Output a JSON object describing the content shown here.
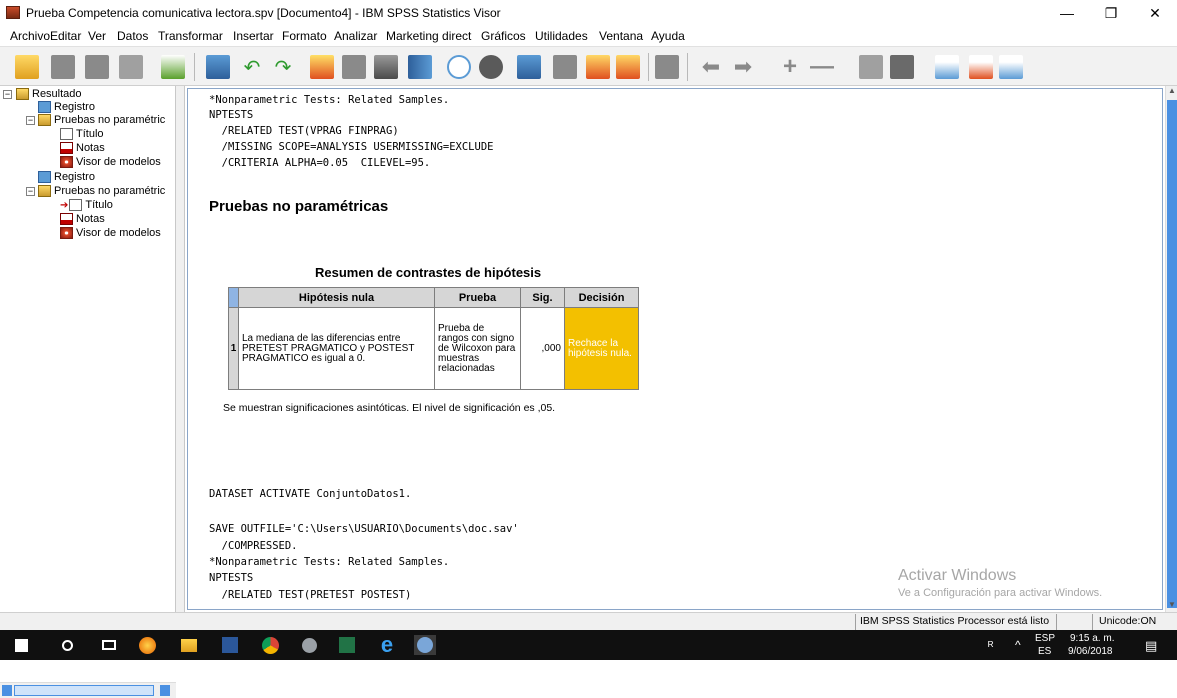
{
  "window": {
    "title": "Prueba Competencia comunicativa lectora.spv [Documento4] - IBM SPSS Statistics Visor",
    "minimize_glyph": "—",
    "maximize_glyph": "❐",
    "close_glyph": "✕"
  },
  "menu": [
    "Archivo",
    "Editar",
    "Ver",
    "Datos",
    "Transformar",
    "Insertar",
    "Formato",
    "Analizar",
    "Marketing direct",
    "Gráficos",
    "Utilidades",
    "Ventana",
    "Ayuda"
  ],
  "toolbar_icons": [
    "open-icon",
    "save-icon",
    "print-icon",
    "print-preview-icon",
    "export-icon",
    "recall-dialog-icon",
    "undo-icon",
    "redo-icon",
    "goto-case-icon",
    "goto-variable-icon",
    "variables-icon",
    "run-descriptives-icon",
    "create-chart-icon",
    "pie-icon",
    "select-cases-icon",
    "value-labels-icon",
    "insert-output-icon",
    "edit-icon",
    "designate-window-icon",
    "back-icon",
    "forward-icon",
    "expand-icon",
    "collapse-icon",
    "show-icon",
    "hide-icon",
    "insert-heading-icon",
    "insert-title-icon",
    "insert-text-icon"
  ],
  "outline": {
    "root": "Resultado",
    "items": [
      {
        "label": "Registro",
        "icon": "log-icon",
        "level": 1
      },
      {
        "label": "Pruebas no paramétric",
        "icon": "book-icon",
        "level": 1
      },
      {
        "label": "Título",
        "icon": "title-icon",
        "level": 2
      },
      {
        "label": "Notas",
        "icon": "notes-icon",
        "level": 2
      },
      {
        "label": "Visor de modelos",
        "icon": "model-viewer-icon",
        "level": 2
      },
      {
        "label": "Registro",
        "icon": "log-icon",
        "level": 1
      },
      {
        "label": "Pruebas no paramétric",
        "icon": "book-icon",
        "level": 1
      },
      {
        "label": "Título",
        "icon": "title-icon",
        "level": 2
      },
      {
        "label": "Notas",
        "icon": "notes-icon",
        "level": 2
      },
      {
        "label": "Visor de modelos",
        "icon": "model-viewer-icon",
        "level": 2
      }
    ]
  },
  "syntax1": {
    "l1": "*Nonparametric Tests: Related Samples.",
    "l2": "NPTESTS",
    "l3": "  /RELATED TEST(VPRAG FINPRAG)",
    "l4": "  /MISSING SCOPE=ANALYSIS USERMISSING=EXCLUDE",
    "l5": "  /CRITERIA ALPHA=0.05  CILEVEL=95."
  },
  "section_heading": "Pruebas no paramétricas",
  "hypothesis_table": {
    "title": "Resumen de contrastes de hipótesis",
    "headers": [
      "Hipótesis nula",
      "Prueba",
      "Sig.",
      "Decisión"
    ],
    "row": {
      "number": "1",
      "hypothesis": "La mediana de las diferencias entre PRETEST PRAGMATICO y POSTEST PRAGMATICO es igual a 0.",
      "test": "Prueba de rangos con signo de Wilcoxon para muestras relacionadas",
      "sig": ",000",
      "decision": "Rechace la hipótesis nula."
    },
    "decision_color": "#f3c000",
    "footnote": "Se muestran significaciones asintóticas.  El nivel de significación es ,05."
  },
  "syntax2": {
    "l1": "DATASET ACTIVATE ConjuntoDatos1.",
    "l2": "SAVE OUTFILE='C:\\Users\\USUARIO\\Documents\\doc.sav'",
    "l3": "  /COMPRESSED.",
    "l4": "*Nonparametric Tests: Related Samples.",
    "l5": "NPTESTS",
    "l6": "  /RELATED TEST(PRETEST POSTEST)"
  },
  "watermark": {
    "line1": "Activar Windows",
    "line2": "Ve a Configuración para activar Windows."
  },
  "status": {
    "processor": "IBM SPSS Statistics Processor está listo",
    "unicode": "Unicode:ON"
  },
  "taskbar": {
    "apps": [
      "windows-start-icon",
      "search-icon",
      "task-view-icon",
      "firefox-icon",
      "file-explorer-icon",
      "word-icon",
      "chrome-icon",
      "app-icon",
      "excel-icon",
      "edge-icon",
      "spss-icon"
    ],
    "lang_top": "ESP",
    "lang_bottom": "ES",
    "time": "9:15 a. m.",
    "date": "9/06/2018"
  },
  "colors": {
    "accent_blue": "#4a90e2",
    "header_gray": "#d6d6d6",
    "decision_yellow": "#f3c000"
  }
}
